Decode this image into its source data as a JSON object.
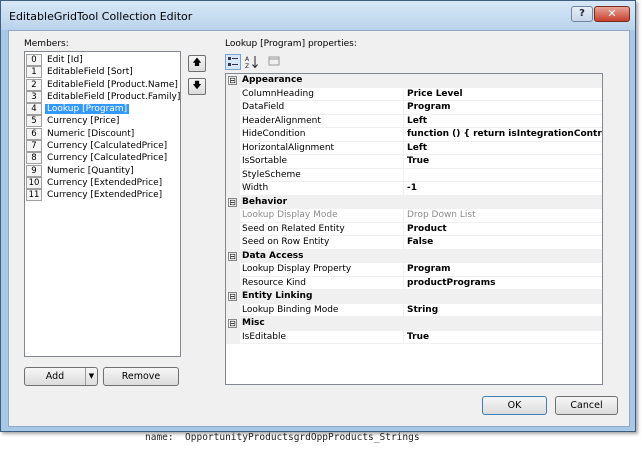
{
  "window": {
    "title": "EditableGridTool Collection Editor",
    "help_label": "?",
    "close_label": "✕"
  },
  "members": {
    "label": "Members:",
    "items": [
      {
        "index": "0",
        "label": "Edit [Id]"
      },
      {
        "index": "1",
        "label": "EditableField [Sort]"
      },
      {
        "index": "2",
        "label": "EditableField [Product.Name]"
      },
      {
        "index": "3",
        "label": "EditableField [Product.Family]"
      },
      {
        "index": "4",
        "label": "Lookup [Program]"
      },
      {
        "index": "5",
        "label": "Currency [Price]"
      },
      {
        "index": "6",
        "label": "Numeric [Discount]"
      },
      {
        "index": "7",
        "label": "Currency [CalculatedPrice]"
      },
      {
        "index": "8",
        "label": "Currency [CalculatedPrice]"
      },
      {
        "index": "9",
        "label": "Numeric [Quantity]"
      },
      {
        "index": "10",
        "label": "Currency [ExtendedPrice]"
      },
      {
        "index": "11",
        "label": "Currency [ExtendedPrice]"
      }
    ],
    "selected_index": 4
  },
  "move": {
    "up_glyph": "🡅",
    "down_glyph": "🡇"
  },
  "buttons": {
    "add": "Add",
    "add_caret": "▼",
    "remove": "Remove",
    "ok": "OK",
    "cancel": "Cancel"
  },
  "properties": {
    "label": "Lookup [Program] properties:",
    "toolbar": {
      "categorized_icon": "categorized-icon",
      "alphabetical_icon": "alphabetical-icon",
      "property_pages_icon": "property-pages-icon"
    },
    "categories": [
      {
        "name": "Appearance",
        "toggle": "⊟",
        "rows": [
          {
            "name": "ColumnHeading",
            "value": "Price Level"
          },
          {
            "name": "DataField",
            "value": "Program"
          },
          {
            "name": "HeaderAlignment",
            "value": "Left"
          },
          {
            "name": "HideCondition",
            "value": "function () {     return isIntegrationContrac"
          },
          {
            "name": "HorizontalAlignment",
            "value": "Left"
          },
          {
            "name": "IsSortable",
            "value": "True"
          },
          {
            "name": "StyleScheme",
            "value": ""
          },
          {
            "name": "Width",
            "value": "-1"
          }
        ]
      },
      {
        "name": "Behavior",
        "toggle": "⊟",
        "rows": [
          {
            "name": "Lookup Display Mode",
            "value": "Drop Down List",
            "disabled": true
          },
          {
            "name": "Seed on Related Entity",
            "value": "Product"
          },
          {
            "name": "Seed on Row Entity",
            "value": "False"
          }
        ]
      },
      {
        "name": "Data Access",
        "toggle": "⊟",
        "rows": [
          {
            "name": "Lookup Display Property",
            "value": "Program"
          },
          {
            "name": "Resource Kind",
            "value": "productPrograms"
          }
        ]
      },
      {
        "name": "Entity Linking",
        "toggle": "⊟",
        "rows": [
          {
            "name": "Lookup Binding Mode",
            "value": "String"
          }
        ]
      },
      {
        "name": "Misc",
        "toggle": "⊟",
        "rows": [
          {
            "name": "IsEditable",
            "value": "True"
          }
        ]
      }
    ]
  },
  "background_code": "name:  OpportunityProductsgrdOppProducts_Strings"
}
